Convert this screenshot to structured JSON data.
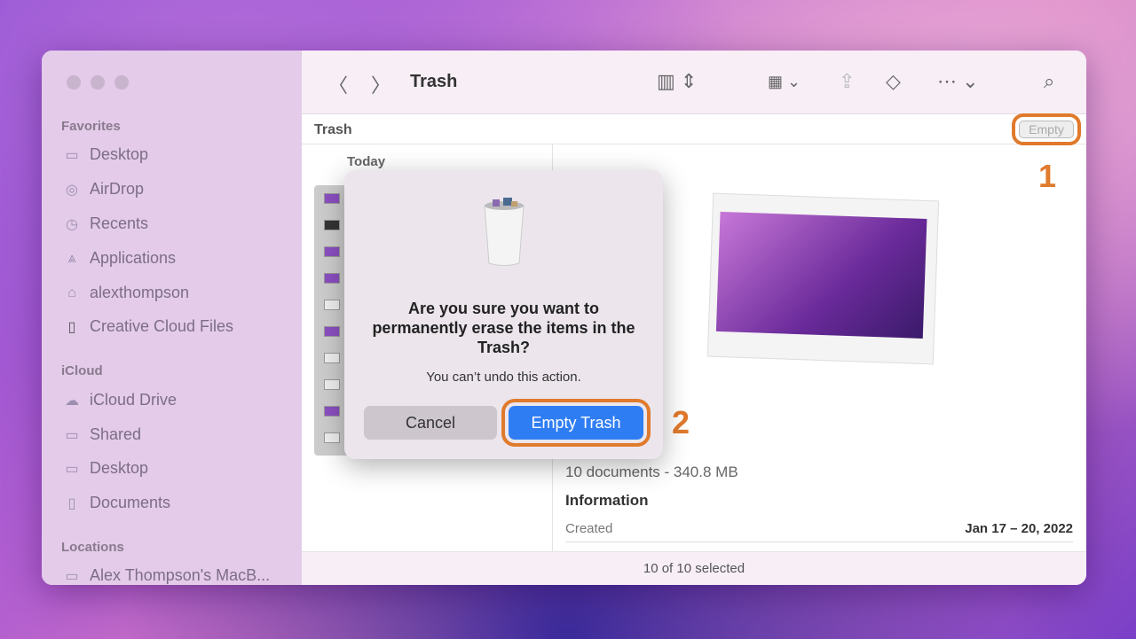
{
  "toolbar": {
    "title": "Trash"
  },
  "sidebar": {
    "favorites_label": "Favorites",
    "favorites": [
      "Desktop",
      "AirDrop",
      "Recents",
      "Applications",
      "alexthompson",
      "Creative Cloud Files"
    ],
    "icloud_label": "iCloud",
    "icloud": [
      "iCloud Drive",
      "Shared",
      "Desktop",
      "Documents"
    ],
    "locations_label": "Locations",
    "locations": [
      "Alex Thompson's MacB..."
    ]
  },
  "pathbar": {
    "title": "Trash",
    "empty_label": "Empty"
  },
  "annotations": {
    "step1": "1",
    "step2": "2",
    "color": "#e07a2c"
  },
  "list": {
    "group": "Today"
  },
  "preview": {
    "summary": "10 documents - 340.8 MB",
    "info_title": "Information",
    "created_label": "Created",
    "created_value": "Jan 17 – 20, 2022"
  },
  "status": {
    "text": "10 of 10 selected"
  },
  "dialog": {
    "title": "Are you sure you want to permanently erase the items in the Trash?",
    "message": "You can’t undo this action.",
    "cancel": "Cancel",
    "confirm": "Empty Trash",
    "accent": "#2f7df3"
  }
}
